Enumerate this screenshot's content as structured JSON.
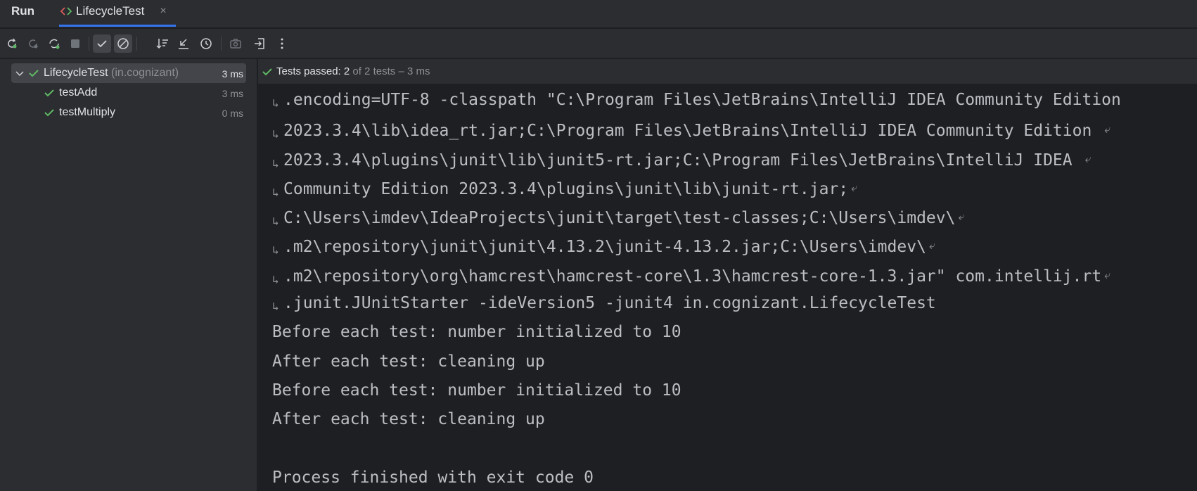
{
  "tabbar": {
    "run_label": "Run",
    "tab_label": "LifecycleTest",
    "tab_close": "×"
  },
  "toolbar": {
    "buttons": [
      "rerun-icon",
      "rerun-failed-icon",
      "toggle-autotest-icon",
      "stop-icon",
      "show-passed-icon",
      "show-ignored-icon",
      "sort-icon",
      "collapse-icon",
      "history-icon",
      "screenshot-icon",
      "export-icon",
      "more-icon"
    ]
  },
  "tree": {
    "root": {
      "name": "LifecycleTest",
      "package": "(in.cognizant)",
      "duration": "3 ms"
    },
    "children": [
      {
        "name": "testAdd",
        "duration": "3 ms"
      },
      {
        "name": "testMultiply",
        "duration": "0 ms"
      }
    ]
  },
  "console": {
    "status_label": "Tests passed:",
    "passed_count": "2",
    "status_rest": "of 2 tests – 3 ms",
    "lines": [
      {
        "text": ".encoding=UTF-8 -classpath \"C:\\Program Files\\JetBrains\\IntelliJ IDEA Community Edition",
        "wrap_in": true,
        "wrap_out": false
      },
      {
        "text": "2023.3.4\\lib\\idea_rt.jar;C:\\Program Files\\JetBrains\\IntelliJ IDEA Community Edition ",
        "wrap_in": true,
        "wrap_out": true
      },
      {
        "text": "2023.3.4\\plugins\\junit\\lib\\junit5-rt.jar;C:\\Program Files\\JetBrains\\IntelliJ IDEA ",
        "wrap_in": true,
        "wrap_out": true
      },
      {
        "text": "Community Edition 2023.3.4\\plugins\\junit\\lib\\junit-rt.jar;",
        "wrap_in": true,
        "wrap_out": true
      },
      {
        "text": "C:\\Users\\imdev\\IdeaProjects\\junit\\target\\test-classes;C:\\Users\\imdev\\",
        "wrap_in": true,
        "wrap_out": true
      },
      {
        "text": ".m2\\repository\\junit\\junit\\4.13.2\\junit-4.13.2.jar;C:\\Users\\imdev\\",
        "wrap_in": true,
        "wrap_out": true
      },
      {
        "text": ".m2\\repository\\org\\hamcrest\\hamcrest-core\\1.3\\hamcrest-core-1.3.jar\" com.intellij.rt",
        "wrap_in": true,
        "wrap_out": true
      },
      {
        "text": ".junit.JUnitStarter -ideVersion5 -junit4 in.cognizant.LifecycleTest",
        "wrap_in": true,
        "wrap_out": false
      },
      {
        "text": "Before each test: number initialized to 10",
        "wrap_in": false,
        "wrap_out": false
      },
      {
        "text": "After each test: cleaning up",
        "wrap_in": false,
        "wrap_out": false
      },
      {
        "text": "Before each test: number initialized to 10",
        "wrap_in": false,
        "wrap_out": false
      },
      {
        "text": "After each test: cleaning up",
        "wrap_in": false,
        "wrap_out": false
      },
      {
        "text": "",
        "wrap_in": false,
        "wrap_out": false
      },
      {
        "text": "Process finished with exit code 0",
        "wrap_in": false,
        "wrap_out": false
      }
    ]
  },
  "colors": {
    "success_green": "#5fb865",
    "accent_blue": "#3574f0",
    "panel_bg": "#2b2d30",
    "console_bg": "#1e1f22"
  }
}
